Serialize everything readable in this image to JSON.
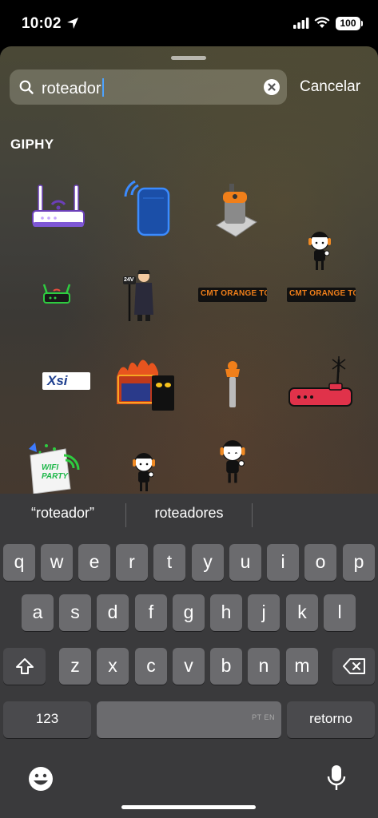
{
  "status_bar": {
    "time": "10:02",
    "battery": "100",
    "icons": [
      "location-arrow-icon",
      "cellular-signal-icon",
      "wifi-icon",
      "battery-icon"
    ]
  },
  "search": {
    "query": "roteador",
    "cancel_label": "Cancelar"
  },
  "results": {
    "section_label": "GIPHY",
    "stickers": [
      {
        "name": "purple-router-sticker"
      },
      {
        "name": "blue-speaker-sticker"
      },
      {
        "name": "router-tool-sticker"
      },
      {
        "name": "girl-headphones-sticker"
      },
      {
        "name": "green-router-sticker"
      },
      {
        "name": "man-with-cable-sticker",
        "text": "24V"
      },
      {
        "name": "cmt-logo-sticker",
        "text": "CMT ORANGE TOOLS"
      },
      {
        "name": "cmt-logo-sticker-2",
        "text": "CMT ORANGE TOOLS"
      },
      {
        "name": "xlsx-logo-sticker",
        "text": "Xsi"
      },
      {
        "name": "burning-desk-cat-sticker"
      },
      {
        "name": "router-bit-sticker"
      },
      {
        "name": "red-router-sticker"
      },
      {
        "name": "wifi-party-sticker",
        "text": "WIFI PARTY"
      },
      {
        "name": "girl-headphones-sticker-2"
      },
      {
        "name": "girl-headphones-sticker-3"
      }
    ]
  },
  "suggestions": [
    "“roteador”",
    "roteadores"
  ],
  "keyboard": {
    "row1": [
      "q",
      "w",
      "e",
      "r",
      "t",
      "y",
      "u",
      "i",
      "o",
      "p"
    ],
    "row2": [
      "a",
      "s",
      "d",
      "f",
      "g",
      "h",
      "j",
      "k",
      "l"
    ],
    "row3": [
      "z",
      "x",
      "c",
      "v",
      "b",
      "n",
      "m"
    ],
    "numbers_label": "123",
    "space_lang": "PT EN",
    "return_label": "retorno"
  },
  "colors": {
    "accent": "#4da3ff",
    "key": "#6b6b6e",
    "key_dark": "#4a4a4d",
    "keyboard_bg": "#3a3a3c"
  }
}
